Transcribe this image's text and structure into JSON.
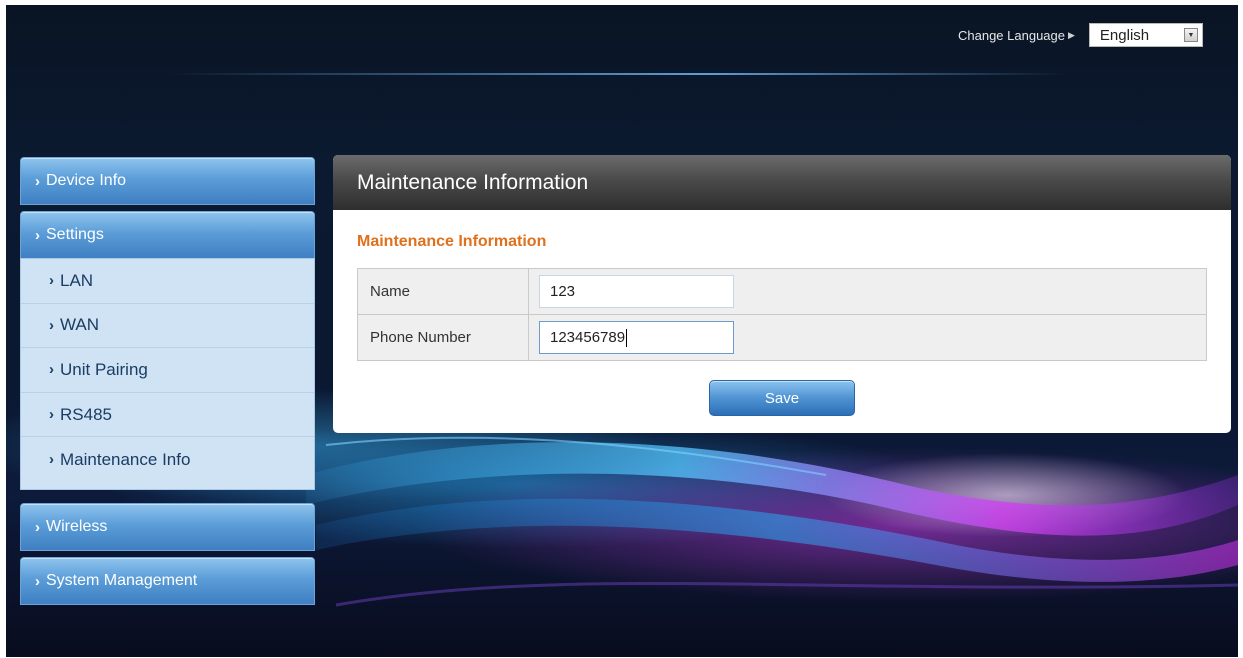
{
  "header": {
    "change_language_label": "Change Language",
    "language_selected": "English"
  },
  "sidebar": {
    "device_info": "Device Info",
    "settings": "Settings",
    "settings_items": [
      "LAN",
      "WAN",
      "Unit Pairing",
      "RS485",
      "Maintenance Info"
    ],
    "wireless": "Wireless",
    "system_management": "System Management"
  },
  "panel": {
    "header_title": "Maintenance Information",
    "section_title": "Maintenance Information",
    "fields": [
      {
        "label": "Name",
        "value": "123"
      },
      {
        "label": "Phone Number",
        "value": "123456789"
      }
    ],
    "save_label": "Save"
  },
  "colors": {
    "section_title": "#e0701c",
    "nav_blue": "#4f93d3",
    "submenu_bg": "#cfe3f5",
    "panel_header": "#3e3e3e"
  }
}
